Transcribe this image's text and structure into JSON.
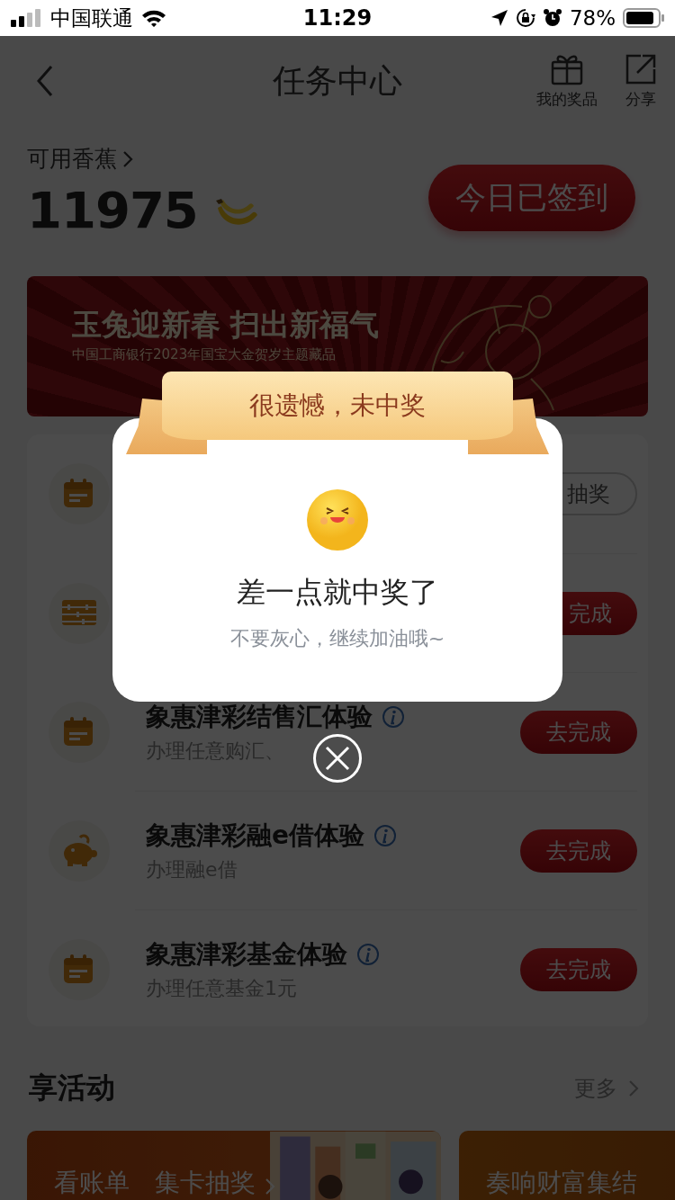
{
  "status_bar": {
    "carrier": "中国联通",
    "time": "11:29",
    "battery": "78%"
  },
  "nav": {
    "title": "任务中心",
    "actions": [
      {
        "kind": "gift",
        "label": "我的奖品"
      },
      {
        "kind": "share",
        "label": "分享"
      }
    ]
  },
  "points": {
    "label": "可用香蕉",
    "value": "11975"
  },
  "checkin_button": "今日已签到",
  "banner": {
    "title": "玉兔迎新春 扫出新福气",
    "subtitle": "中国工商银行2023年国宝大金贺岁主题藏品"
  },
  "tasks": [
    {
      "kind": "calendar",
      "button": "抽奖",
      "button_outlined": true
    },
    {
      "kind": "abacus",
      "button": "完成",
      "button_outlined": false
    },
    {
      "kind": "calendar",
      "title": "象惠津彩结售汇体验",
      "info": true,
      "subtitle": "办理任意购汇、",
      "button": "去完成",
      "button_outlined": false
    },
    {
      "kind": "piggy",
      "title": "象惠津彩融e借体验",
      "info": true,
      "subtitle": "办理融e借",
      "button": "去完成",
      "button_outlined": false
    },
    {
      "kind": "calendar",
      "title": "象惠津彩基金体验",
      "info": true,
      "subtitle": "办理任意基金1元",
      "button": "去完成",
      "button_outlined": false
    }
  ],
  "activities": {
    "title": "享活动",
    "more": "更多",
    "cards": [
      {
        "title": "看账单　集卡抽奖",
        "kind": "picture"
      },
      {
        "title": "奏响财富集结"
      }
    ]
  },
  "modal": {
    "ribbon": "很遗憾，未中奖",
    "heading": "差一点就中奖了",
    "message": "不要灰心，继续加油哦~"
  }
}
